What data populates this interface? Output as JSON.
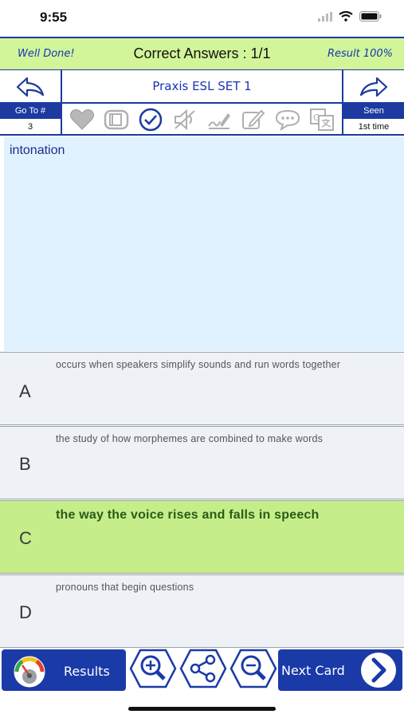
{
  "status_bar": {
    "time": "9:55"
  },
  "header": {
    "feedback": "Well Done!",
    "correct_answers": "Correct Answers : 1/1",
    "result": "Result 100%"
  },
  "nav": {
    "set_title": "Praxis ESL SET 1"
  },
  "goto": {
    "label": "Go To #",
    "value": "3"
  },
  "seen": {
    "label": "Seen",
    "value": "1st time"
  },
  "toolbar_icons": [
    "heart-icon",
    "book-icon",
    "check-circle-icon",
    "mute-icon",
    "signature-icon",
    "edit-icon",
    "speech-bubble-icon",
    "translate-icon"
  ],
  "question": {
    "text": "intonation"
  },
  "answers": [
    {
      "letter": "A",
      "text": "occurs when speakers simplify sounds and run words together",
      "correct": false
    },
    {
      "letter": "B",
      "text": "the study of how morphemes are combined to make words",
      "correct": false
    },
    {
      "letter": "C",
      "text": "the way the voice rises and falls in speech",
      "correct": true
    },
    {
      "letter": "D",
      "text": "pronouns that begin questions",
      "correct": false
    }
  ],
  "bottom": {
    "results_label": "Results",
    "next_label": "Next Card"
  },
  "colors": {
    "accent_blue": "#1a3aa8",
    "header_green": "#d2f59a",
    "correct_green": "#c5ee8a",
    "question_bg": "#e0f1ff"
  }
}
